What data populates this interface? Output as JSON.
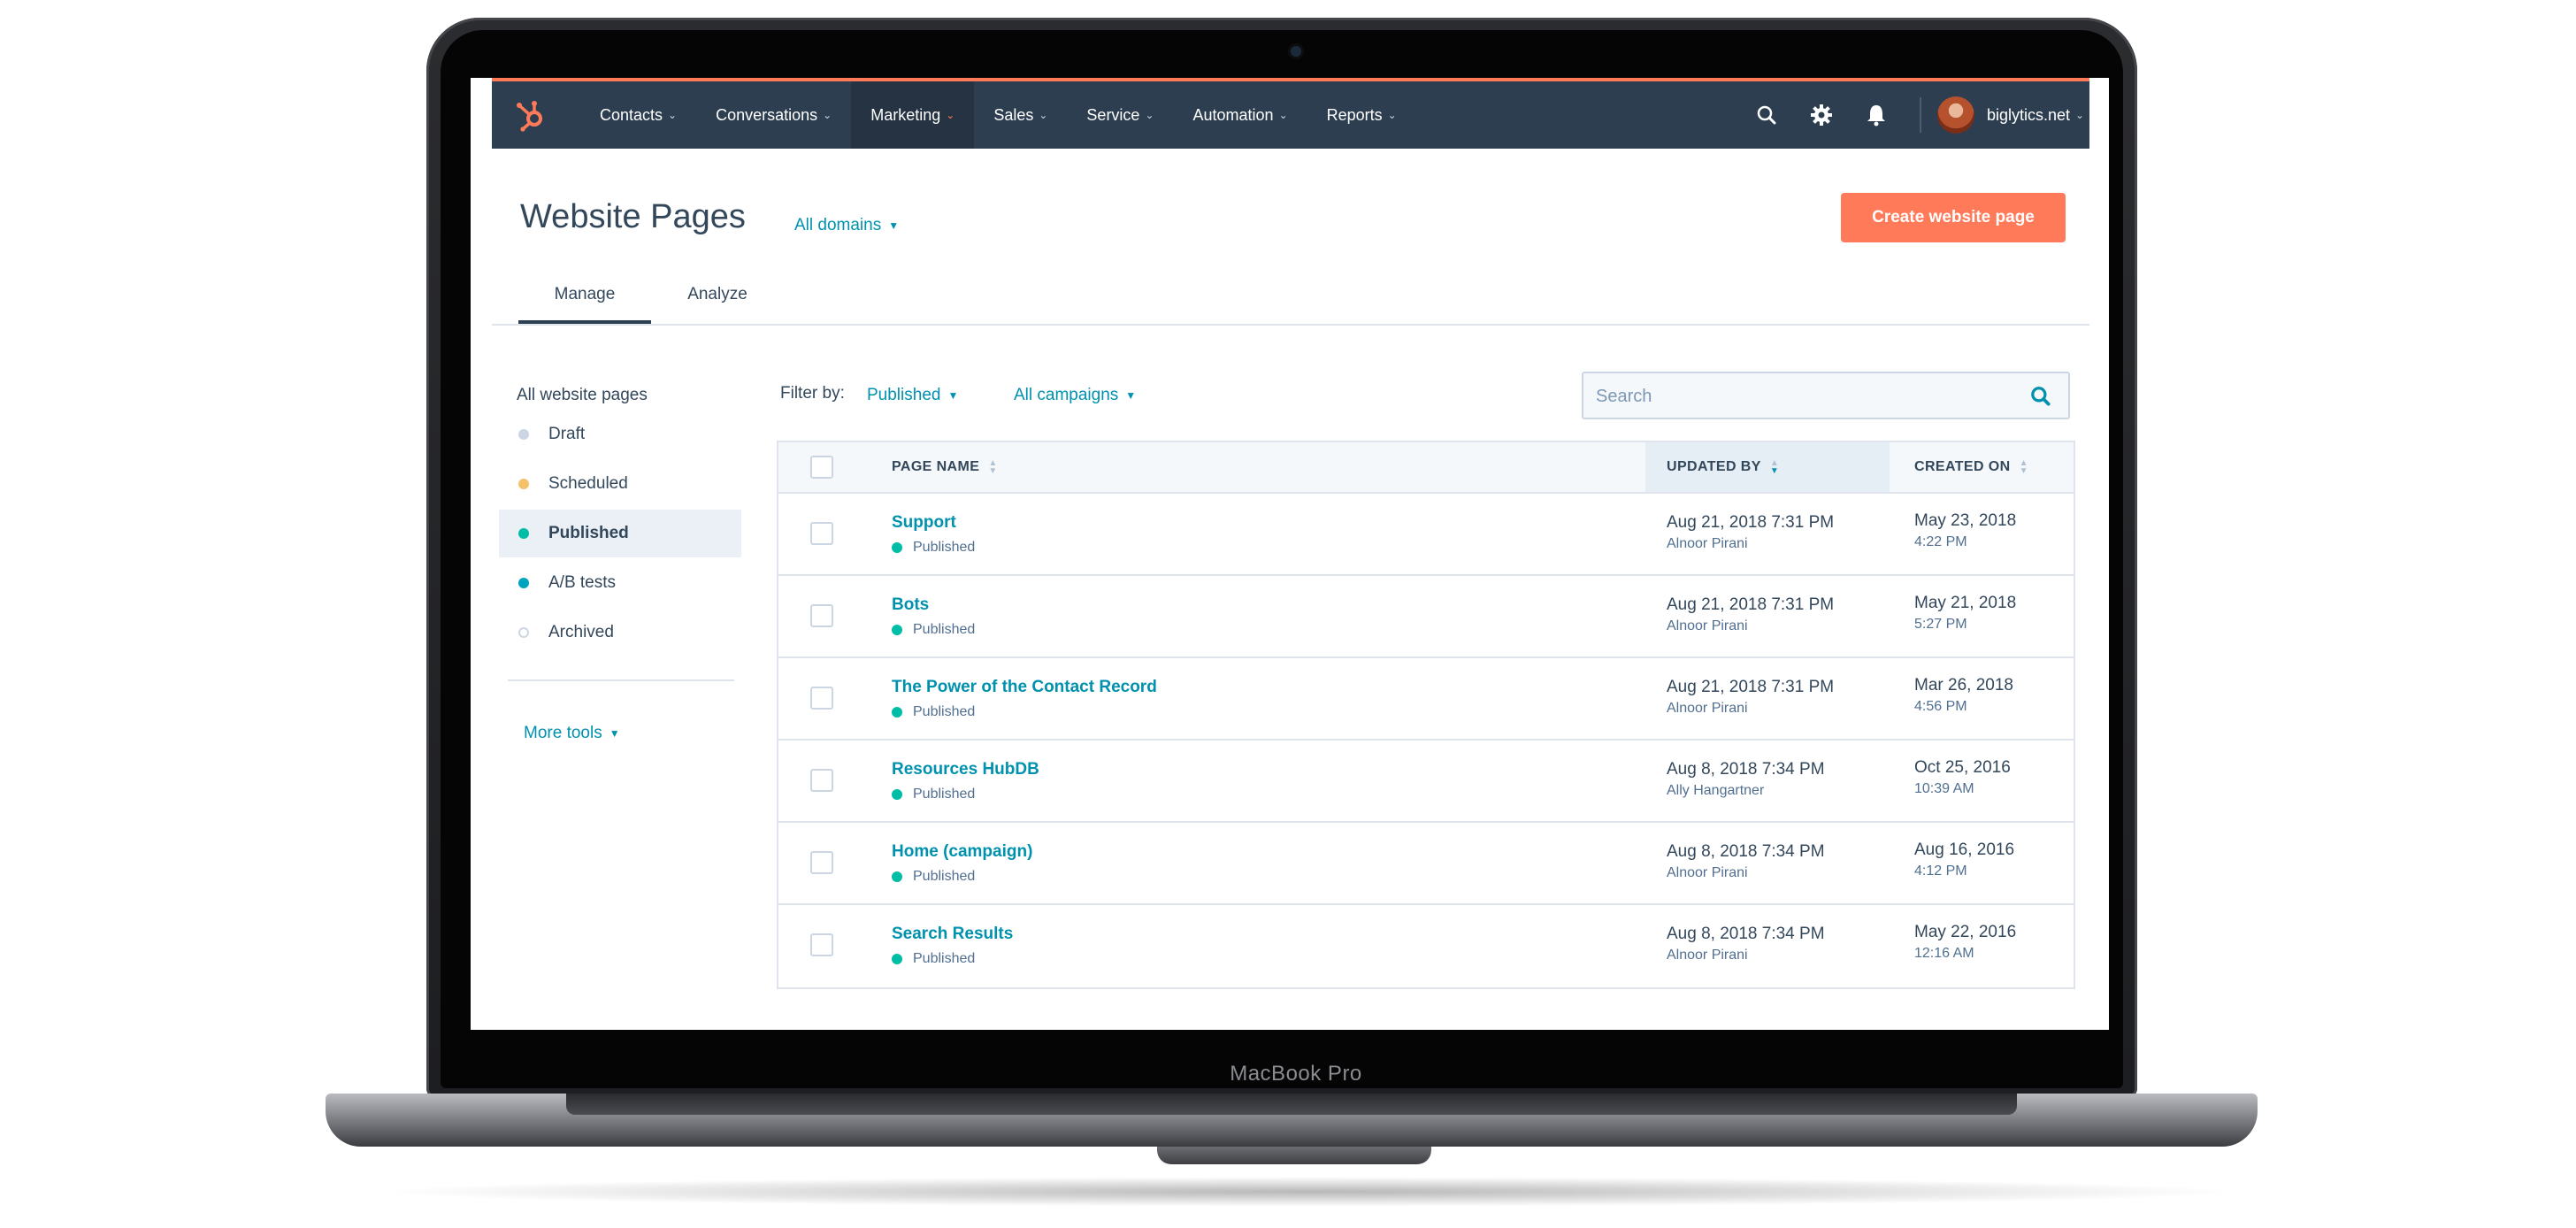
{
  "device": {
    "label": "MacBook Pro"
  },
  "colors": {
    "brand": "#ff7a59",
    "nav": "#2d3e50",
    "link": "#0091ae",
    "published": "#00bda5",
    "scheduled": "#f5c26b",
    "draft": "#cbd6e2"
  },
  "topnav": {
    "items": [
      {
        "label": "Contacts"
      },
      {
        "label": "Conversations"
      },
      {
        "label": "Marketing",
        "active": true
      },
      {
        "label": "Sales"
      },
      {
        "label": "Service"
      },
      {
        "label": "Automation"
      },
      {
        "label": "Reports"
      }
    ],
    "icons": [
      "search-icon",
      "gear-icon",
      "bell-icon"
    ],
    "account": "biglytics.net"
  },
  "header": {
    "title": "Website Pages",
    "domains": "All domains",
    "create_button": "Create website page"
  },
  "tabs": [
    {
      "label": "Manage",
      "active": true
    },
    {
      "label": "Analyze"
    }
  ],
  "sidebar": {
    "heading": "All website pages",
    "items": [
      {
        "label": "Draft",
        "color": "#cbd6e2"
      },
      {
        "label": "Scheduled",
        "color": "#f5c26b"
      },
      {
        "label": "Published",
        "color": "#00bda5",
        "active": true
      },
      {
        "label": "A/B tests",
        "color": "#00a4bd"
      },
      {
        "label": "Archived",
        "color": "#ffffff"
      }
    ],
    "more_tools": "More tools"
  },
  "filters": {
    "label": "Filter by:",
    "status": "Published",
    "campaigns": "All campaigns",
    "search_placeholder": "Search"
  },
  "table": {
    "columns": {
      "page_name": "PAGE NAME",
      "updated_by": "UPDATED BY",
      "created_on": "CREATED ON"
    },
    "rows": [
      {
        "name": "Support",
        "status": "Published",
        "updated": "Aug 21, 2018 7:31 PM",
        "updated_by": "Alnoor Pirani",
        "created": "May 23, 2018",
        "created_time": "4:22 PM"
      },
      {
        "name": "Bots",
        "status": "Published",
        "updated": "Aug 21, 2018 7:31 PM",
        "updated_by": "Alnoor Pirani",
        "created": "May 21, 2018",
        "created_time": "5:27 PM"
      },
      {
        "name": "The Power of the Contact Record",
        "status": "Published",
        "updated": "Aug 21, 2018 7:31 PM",
        "updated_by": "Alnoor Pirani",
        "created": "Mar 26, 2018",
        "created_time": "4:56 PM"
      },
      {
        "name": "Resources HubDB",
        "status": "Published",
        "updated": "Aug 8, 2018 7:34 PM",
        "updated_by": "Ally Hangartner",
        "created": "Oct 25, 2016",
        "created_time": "10:39 AM"
      },
      {
        "name": "Home (campaign)",
        "status": "Published",
        "updated": "Aug 8, 2018 7:34 PM",
        "updated_by": "Alnoor Pirani",
        "created": "Aug 16, 2016",
        "created_time": "4:12 PM"
      },
      {
        "name": "Search Results",
        "status": "Published",
        "updated": "Aug 8, 2018 7:34 PM",
        "updated_by": "Alnoor Pirani",
        "created": "May 22, 2016",
        "created_time": "12:16 AM"
      }
    ]
  }
}
